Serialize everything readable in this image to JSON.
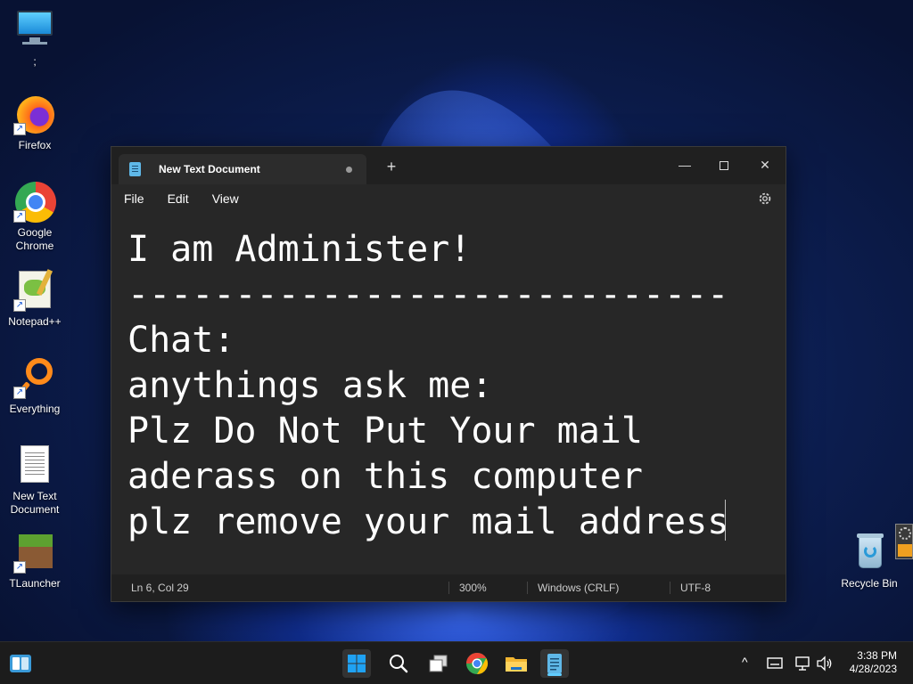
{
  "desktop": {
    "icons": [
      {
        "label": ";"
      },
      {
        "label": "Firefox"
      },
      {
        "label": "Google Chrome"
      },
      {
        "label": "Notepad++"
      },
      {
        "label": "Everything"
      },
      {
        "label": "New Text Document"
      },
      {
        "label": "TLauncher"
      },
      {
        "label": "Recycle Bin"
      }
    ],
    "shortcut_glyph": "↗"
  },
  "window": {
    "tab_title": "New Text Document",
    "new_tab_glyph": "+",
    "minimize_glyph": "—",
    "close_glyph": "✕",
    "menu": {
      "file": "File",
      "edit": "Edit",
      "view": "View"
    },
    "content_lines": [
      "I am Administer!",
      "----------------------------",
      "Chat:",
      "anythings ask me:",
      "Plz Do Not Put Your mail",
      "aderass on this computer",
      "plz remove your mail address"
    ],
    "status": {
      "position": "Ln 6, Col 29",
      "zoom": "300%",
      "line_ending": "Windows (CRLF)",
      "encoding": "UTF-8"
    }
  },
  "taskbar": {
    "clock_time": "3:38 PM",
    "clock_date": "4/28/2023",
    "tray_chevron": "^"
  },
  "colors": {
    "accent": "#60cdff",
    "window_bg": "#272727",
    "taskbar_bg": "#1c1c1c"
  }
}
